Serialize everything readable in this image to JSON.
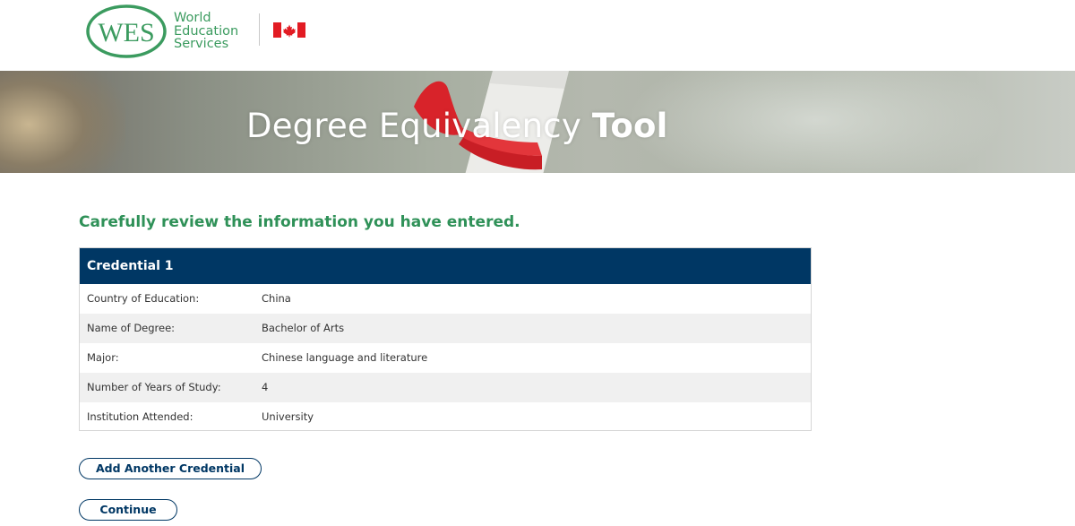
{
  "header": {
    "logo_text": "WES",
    "brand_lines": [
      "World",
      "Education",
      "Services"
    ],
    "flag_icon": "canada-flag-icon"
  },
  "hero": {
    "title_light": "Degree Equivalency",
    "title_bold": "Tool"
  },
  "review": {
    "heading": "Carefully review the information you have entered."
  },
  "credential": {
    "title": "Credential 1",
    "rows": [
      {
        "label": "Country of Education:",
        "value": "China"
      },
      {
        "label": "Name of Degree:",
        "value": "Bachelor of Arts"
      },
      {
        "label": "Major:",
        "value": "Chinese language and literature"
      },
      {
        "label": "Number of Years of Study:",
        "value": "4"
      },
      {
        "label": "Institution Attended:",
        "value": "University"
      }
    ]
  },
  "actions": {
    "add_label": "Add Another Credential",
    "continue_label": "Continue"
  },
  "colors": {
    "brand_green": "#3b9b5f",
    "heading_green": "#2f9158",
    "navy": "#003764",
    "flag_red": "#e21b23"
  }
}
